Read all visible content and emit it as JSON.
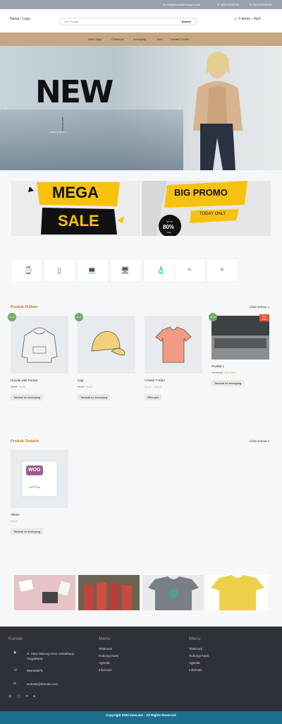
{
  "topbar": {
    "email": "info@emeraldeveloper.com",
    "phone1": "081123456789",
    "phone2": "081123456789"
  },
  "header": {
    "logo": "Nama / Logo",
    "search_placeholder": "Cari Produk",
    "search_button": "Search",
    "cart": "0 items – Rp0"
  },
  "nav": [
    "Akun Saya",
    "Checkout",
    "Keranjang",
    "Toko",
    "Laman Contoh"
  ],
  "hero": {
    "headline": "NEW",
    "tagline": "COLLECTION",
    "cta": "SHOP NOW  IN »"
  },
  "banners": {
    "mega1": "MEGA",
    "mega2": "SALE",
    "promo": "BIG PROMO",
    "today": "TODAY ONLY",
    "upto": "UP TO",
    "pct": "80%",
    "off": "OFF"
  },
  "categories": [
    "watch-icon",
    "wardrobe-icon",
    "laptop-icon",
    "monitor-icon",
    "bottle-icon",
    "image-icon",
    "image-icon"
  ],
  "featured": {
    "title": "Produk Pilihan",
    "see_all": "Lihat semua »",
    "products": [
      {
        "name": "Hoodie with Pocket",
        "old": "Rp45",
        "price": "Rp35",
        "button": "Tambah ke keranjang",
        "badge": "Obral!"
      },
      {
        "name": "Cap",
        "old": "Rp18",
        "price": "Rp16",
        "button": "Tambah ke keranjang",
        "badge": "Obral!"
      },
      {
        "name": "V-Neck T-Shirt",
        "old": "",
        "price": "Rp15 – Rp20",
        "button": "Pilih opsi",
        "badge": "Obral!"
      },
      {
        "name": "Produk 1",
        "old": "Rp40000",
        "price": "Rp20000",
        "button": "Tambah ke keranjang",
        "badge": "Obral!",
        "hot": "Best Seller"
      }
    ]
  },
  "latest": {
    "title": "Produk Terlaris",
    "see_all": "Lihat semua »",
    "products": [
      {
        "name": "Album",
        "price": "Rp15",
        "button": "Tambah ke keranjang",
        "logo": "WOO"
      }
    ]
  },
  "footer": {
    "col1_title": "Kontak",
    "address": "Jl. Situs Warung Soto Umbulharjo Yogyakarta",
    "phone": "084404876",
    "email": "website@domain.com",
    "col2_title": "Menu",
    "col2_links": [
      "Testimoni",
      "Hubungi Kami",
      "Agenda",
      "Informasi"
    ],
    "col3_title": "Menu",
    "col3_links": [
      "Testimoni",
      "Hubungi Kami",
      "Agenda",
      "Informasi"
    ],
    "copyright": "Copyright 2020 Inwn.dev - All Rights Reserved"
  },
  "colors": {
    "accent": "#d4731c",
    "nav_bg": "#c4a884",
    "footer_bg": "#2e3138",
    "copyright_bg": "#1d6f8e",
    "sale_badge": "#74a96a",
    "promo_yellow": "#f7c20e"
  }
}
